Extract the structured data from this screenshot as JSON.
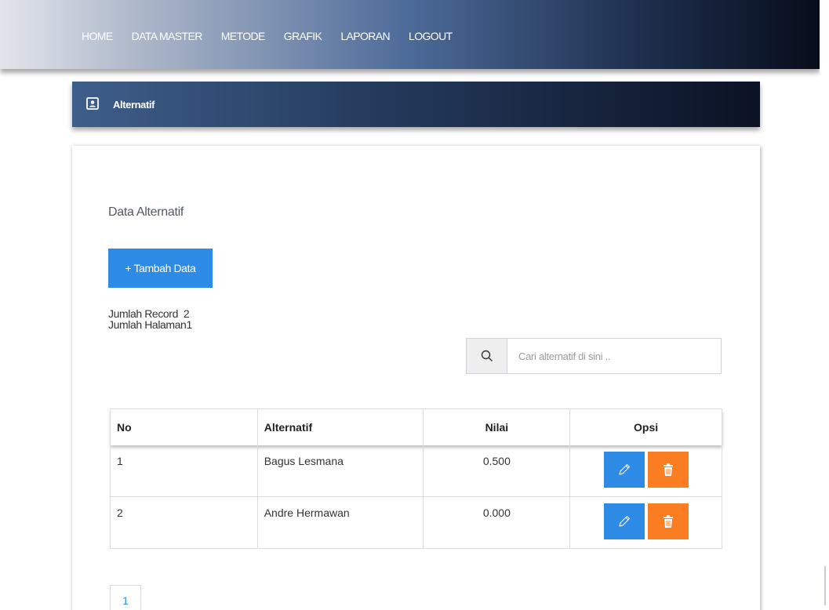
{
  "nav": {
    "items": [
      "HOME",
      "DATA MASTER",
      "METODE",
      "GRAFIK",
      "LAPORAN",
      "LOGOUT"
    ]
  },
  "header": {
    "title": "Alternatif",
    "icon": "contact-card-icon"
  },
  "content": {
    "title": "Data Alternatif",
    "add_button": "+ Tambah Data",
    "record_count_label": "Jumlah Record  2",
    "page_count_label": "Jumlah Halaman1",
    "search_placeholder": "Cari alternatif di sini ..",
    "search_icon": "search-icon"
  },
  "table": {
    "headers": [
      "No",
      "Alternatif",
      "Nilai",
      "Opsi"
    ],
    "rows": [
      {
        "no": "1",
        "alternatif": "Bagus Lesmana",
        "nilai": "0.500"
      },
      {
        "no": "2",
        "alternatif": "Andre Hermawan",
        "nilai": "0.000"
      }
    ]
  },
  "pagination": {
    "current": "1"
  },
  "colors": {
    "primary": "#2d8be5",
    "danger": "#fb7d21",
    "navy": "#1e2f4e"
  }
}
